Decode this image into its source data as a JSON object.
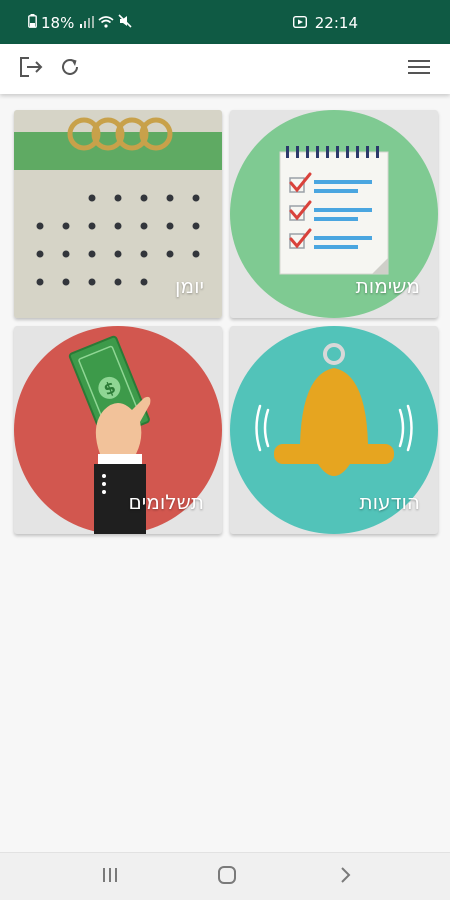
{
  "status_bar": {
    "battery_icon": "battery-icon",
    "battery_percent": "18%",
    "signal_icon": "signal-icon",
    "wifi_icon": "wifi-icon",
    "mute_icon": "mute-icon",
    "media_icon": "media-icon",
    "time": "22:14",
    "background": "#0f5a44"
  },
  "app_bar": {
    "logout_icon": "logout-icon",
    "refresh_icon": "refresh-icon",
    "menu_icon": "hamburger-menu-icon"
  },
  "tiles": [
    {
      "label": "משימות",
      "icon": "checklist-icon",
      "circle_color": "#7fca92"
    },
    {
      "label": "יומן",
      "icon": "calendar-icon",
      "circle_color": "#5faa63"
    },
    {
      "label": "הודעות",
      "icon": "bell-icon",
      "circle_color": "#52c3b9"
    },
    {
      "label": "תשלומים",
      "icon": "payment-hand-icon",
      "circle_color": "#d2574f"
    }
  ],
  "nav_bar": {
    "recents_icon": "recents-icon",
    "home_icon": "home-icon",
    "back_icon": "back-icon"
  }
}
